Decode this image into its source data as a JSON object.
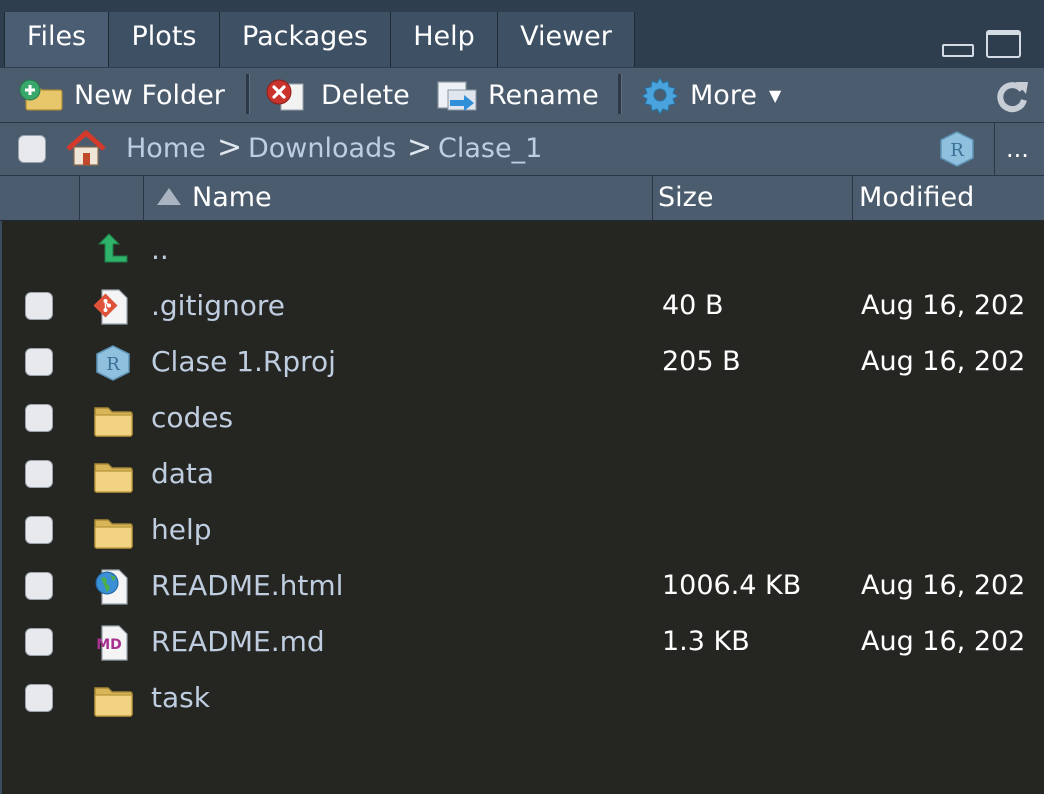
{
  "tabs": [
    {
      "label": "Files",
      "active": true
    },
    {
      "label": "Plots",
      "active": false
    },
    {
      "label": "Packages",
      "active": false
    },
    {
      "label": "Help",
      "active": false
    },
    {
      "label": "Viewer",
      "active": false
    }
  ],
  "toolbar": {
    "new_folder": "New Folder",
    "delete": "Delete",
    "rename": "Rename",
    "more": "More"
  },
  "path": {
    "home": "Home",
    "crumbs": [
      "Downloads",
      "Clase_1"
    ],
    "separator": ">",
    "overflow": "..."
  },
  "columns": {
    "name": "Name",
    "size": "Size",
    "modified": "Modified"
  },
  "parent_dir": "..",
  "files": [
    {
      "name": ".gitignore",
      "size": "40 B",
      "modified": "Aug 16, 202",
      "icon": "git-file-icon"
    },
    {
      "name": "Clase 1.Rproj",
      "size": "205 B",
      "modified": "Aug 16, 202",
      "icon": "rproj-icon"
    },
    {
      "name": "codes",
      "size": "",
      "modified": "",
      "icon": "folder-icon"
    },
    {
      "name": "data",
      "size": "",
      "modified": "",
      "icon": "folder-icon"
    },
    {
      "name": "help",
      "size": "",
      "modified": "",
      "icon": "folder-icon"
    },
    {
      "name": "README.html",
      "size": "1006.4 KB",
      "modified": "Aug 16, 202",
      "icon": "html-file-icon"
    },
    {
      "name": "README.md",
      "size": "1.3 KB",
      "modified": "Aug 16, 202",
      "icon": "markdown-file-icon"
    },
    {
      "name": "task",
      "size": "",
      "modified": "",
      "icon": "folder-icon"
    }
  ],
  "colors": {
    "background": "#252521",
    "toolbar": "#4b5c6e",
    "link_text": "#bfcde0"
  }
}
